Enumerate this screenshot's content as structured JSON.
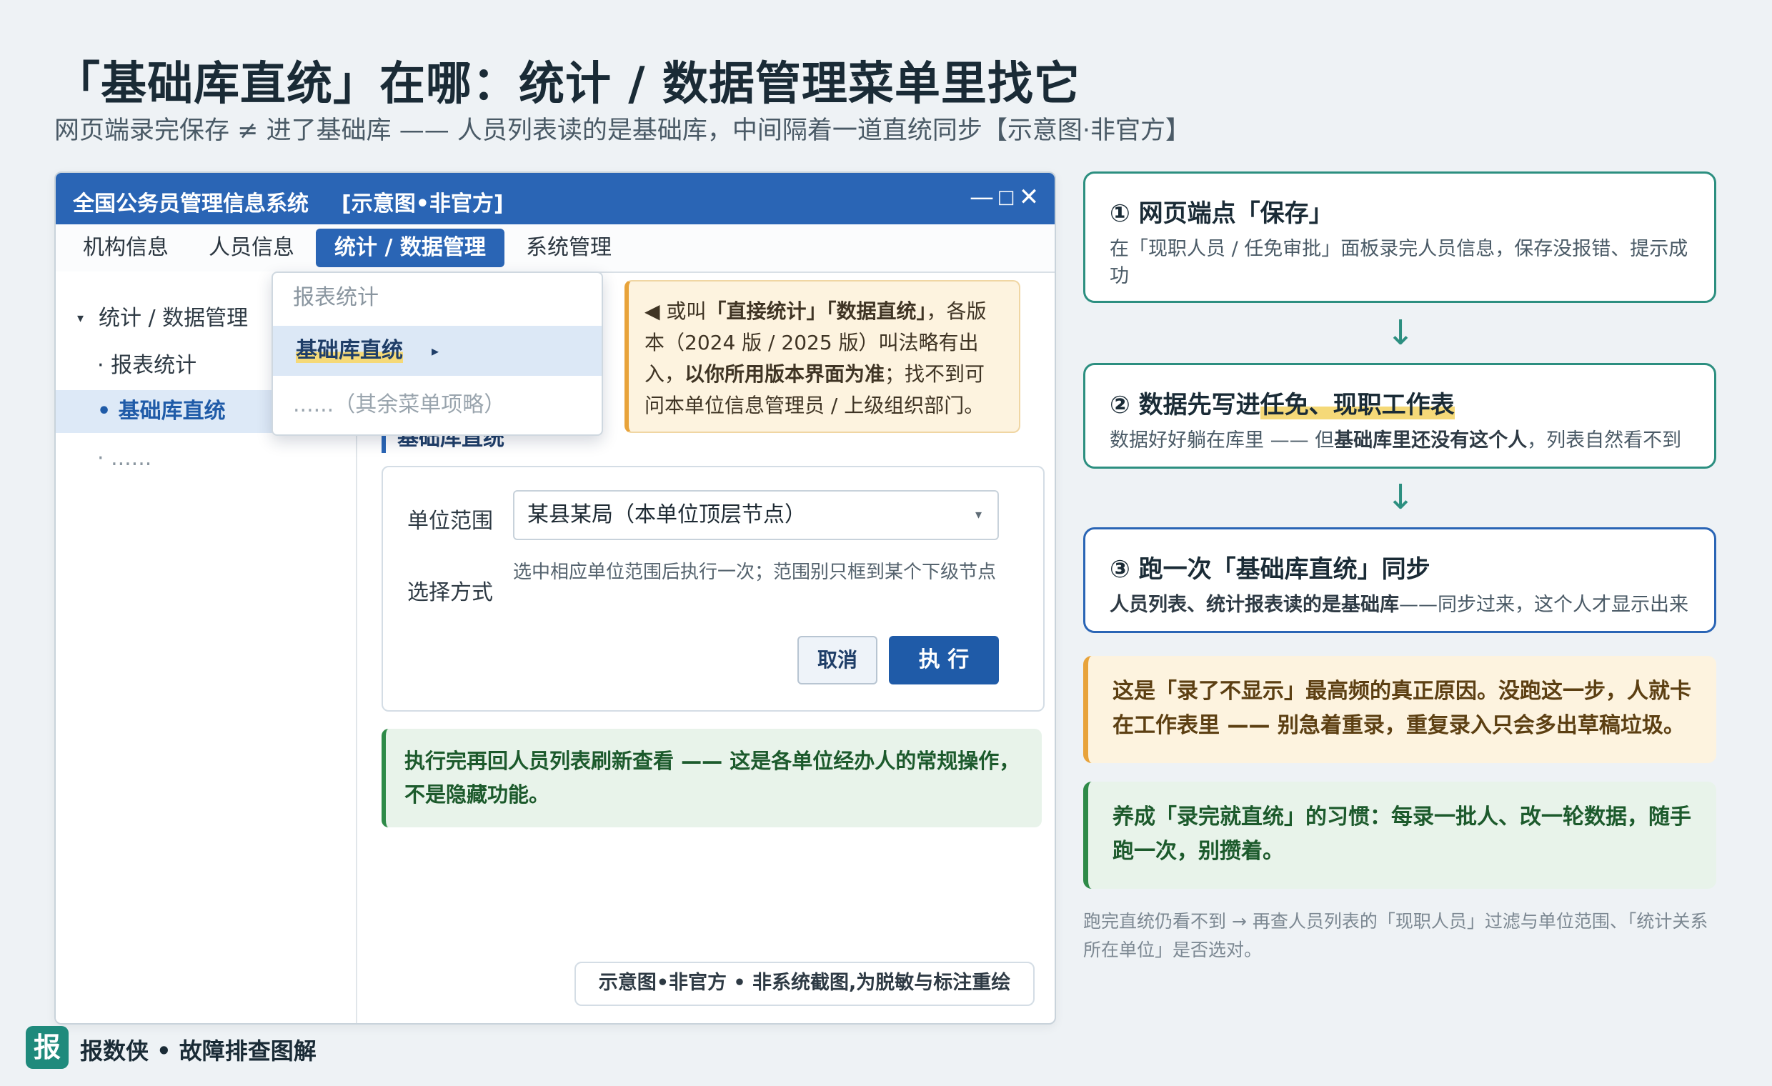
{
  "header": {
    "title": "「基础库直统」在哪：统计 / 数据管理菜单里找它",
    "subtitle": "网页端录完保存 ≠ 进了基础库 —— 人员列表读的是基础库，中间隔着一道直统同步【示意图·非官方】"
  },
  "window": {
    "app_title": "全国公务员管理信息系统",
    "app_tag": "[示意图•非官方]",
    "controls": {
      "minimize": "—",
      "maximize": "□",
      "close": "✕"
    },
    "menu": [
      "机构信息",
      "人员信息",
      "统计 / 数据管理",
      "系统管理"
    ],
    "sidebar": {
      "group": "统计 / 数据管理",
      "items": [
        "· 报表统计",
        "• 基础库直统",
        "· ......"
      ]
    },
    "dropdown": {
      "items": [
        "报表统计",
        "基础库直统",
        "......（其余菜单项略）"
      ],
      "submenu_arrow": "▸"
    },
    "note": {
      "prefix": "◀ 或叫",
      "name1": "「直接统计」",
      "name2": "「数据直统」",
      "mid": "，各版本（2024 版 / 2025 版）叫法略有出入，",
      "strong": "以你所用版本界面为准",
      "tail": "；找不到可问本单位信息管理员 / 上级组织部门。"
    },
    "section_heading": "基础库直统",
    "form": {
      "scope_label": "单位范围",
      "scope_value": "某县某局（本单位顶层节点）",
      "mode_label": "选择方式",
      "mode_hint": "选中相应单位范围后执行一次；范围别只框到某个下级节点",
      "cancel": "取消",
      "run": "执 行"
    },
    "tip": "执行完再回人员列表刷新查看 —— 这是各单位经办人的常规操作，不是隐藏功能。",
    "disclaimer": "示意图•非官方 • 非系统截图,为脱敏与标注重绘"
  },
  "steps": [
    {
      "title": "① 网页端点「保存」",
      "desc": "在「现职人员 / 任免审批」面板录完人员信息，保存没报错、提示成功"
    },
    {
      "title_pre": "② 数据先写进",
      "title_hl": "任免、现职工作表",
      "desc_pre": "数据好好躺在库里 —— 但",
      "desc_strong": "基础库里还没有这个人",
      "desc_post": "，列表自然看不到"
    },
    {
      "title": "③ 跑一次「基础库直统」同步",
      "desc_strong": "人员列表、统计报表读的是基础库",
      "desc_post": "——同步过来，这个人才显示出来"
    }
  ],
  "arrows": [
    "↓",
    "↓"
  ],
  "warning": "这是「录了不显示」最高频的真正原因。没跑这一步，人就卡在工作表里 —— 别急着重录，重复录入只会多出草稿垃圾。",
  "habit": "养成「录完就直统」的习惯：每录一批人、改一轮数据，随手跑一次，别攒着。",
  "footnote": "跑完直统仍看不到 → 再查人员列表的「现职人员」过滤与单位范围、「统计关系所在单位」是否选对。",
  "brand": {
    "badge": "报",
    "text": "报数侠 • 故障排查图解"
  },
  "colors": {
    "primary": "#2a65b5",
    "teal": "#2c8f80",
    "orange": "#e8a33a",
    "green": "#2e8a48",
    "highlight": "#f5d978"
  }
}
